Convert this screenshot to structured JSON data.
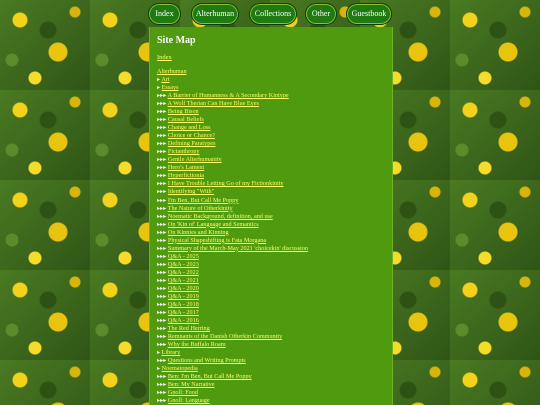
{
  "nav": {
    "items": [
      "Index",
      "Alterhuman",
      "Collections",
      "Other",
      "Guestbook"
    ]
  },
  "page": {
    "title": "Site Map",
    "index_link": "Index",
    "section_heading": "Alterhuman"
  },
  "tree": [
    {
      "prefix": "▸ ",
      "label": "Art"
    },
    {
      "prefix": "▸ ",
      "label": "Essays"
    },
    {
      "prefix": "▸▸▸ ",
      "label": "A Barrier of Humanness & A Secondary Kintype"
    },
    {
      "prefix": "▸▸▸ ",
      "label": "A Wolf Therian Can Have Blue Eyes"
    },
    {
      "prefix": "▸▸▸ ",
      "label": "Being Bison"
    },
    {
      "prefix": "▸▸▸ ",
      "label": "Causal Beliefs"
    },
    {
      "prefix": "▸▸▸ ",
      "label": "Change and Loss"
    },
    {
      "prefix": "▸▸▸ ",
      "label": "Choice or Chance?"
    },
    {
      "prefix": "▸▸▸ ",
      "label": "Defining Paratypes"
    },
    {
      "prefix": "▸▸▸ ",
      "label": "Fictanthropy"
    },
    {
      "prefix": "▸▸▸ ",
      "label": "Gentle Alterhumanity"
    },
    {
      "prefix": "▸▸▸ ",
      "label": "Hero's Lament"
    },
    {
      "prefix": "▸▸▸ ",
      "label": "Hyperfictionia"
    },
    {
      "prefix": "▸▸▸ ",
      "label": "I Have Trouble Letting Go of my Fictionkinity"
    },
    {
      "prefix": "▸▸▸ ",
      "label": "Identifying \"With\""
    },
    {
      "prefix": "▸▸▸ ",
      "label": "I'm Ben, But Call Me Poppy"
    },
    {
      "prefix": "▸▸▸ ",
      "label": "The Nature of Otherkinity"
    },
    {
      "prefix": "▸▸▸ ",
      "label": "Noematic Background, definition, and use"
    },
    {
      "prefix": "▸▸▸ ",
      "label": "On 'Kin of' Language and Semantics"
    },
    {
      "prefix": "▸▸▸ ",
      "label": "On Kinnies and Kinning"
    },
    {
      "prefix": "▸▸▸ ",
      "label": "Physical Shapeshifting is Fata Morgana"
    },
    {
      "prefix": "▸▸▸ ",
      "label": "Summary of the March-May 2021 'choicekin' discussion"
    },
    {
      "prefix": "▸▸▸ ",
      "label": "Q&A - 2025"
    },
    {
      "prefix": "▸▸▸ ",
      "label": "Q&A - 2023"
    },
    {
      "prefix": "▸▸▸ ",
      "label": "Q&A - 2022"
    },
    {
      "prefix": "▸▸▸ ",
      "label": "Q&A - 2021"
    },
    {
      "prefix": "▸▸▸ ",
      "label": "Q&A - 2020"
    },
    {
      "prefix": "▸▸▸ ",
      "label": "Q&A - 2019"
    },
    {
      "prefix": "▸▸▸ ",
      "label": "Q&A - 2018"
    },
    {
      "prefix": "▸▸▸ ",
      "label": "Q&A - 2017"
    },
    {
      "prefix": "▸▸▸ ",
      "label": "Q&A - 2016"
    },
    {
      "prefix": "▸▸▸ ",
      "label": "The Red Herring"
    },
    {
      "prefix": "▸▸▸ ",
      "label": "Remnants of the Danish Otherkin Community"
    },
    {
      "prefix": "▸▸▸ ",
      "label": "Why the Buffalo Roam"
    },
    {
      "prefix": "▸ ",
      "label": "Library"
    },
    {
      "prefix": "▸▸▸ ",
      "label": "Questions and Writing Prompts"
    },
    {
      "prefix": "▸ ",
      "label": "Noematopedia"
    },
    {
      "prefix": "▸▸▸ ",
      "label": "Ben: I'm Ben, But Call Me Poppy"
    },
    {
      "prefix": "▸▸▸ ",
      "label": "Ben: My Narrative"
    },
    {
      "prefix": "▸▸▸ ",
      "label": "Gnoll: Food"
    },
    {
      "prefix": "▸▸▸ ",
      "label": "Gnoll: Language"
    }
  ]
}
